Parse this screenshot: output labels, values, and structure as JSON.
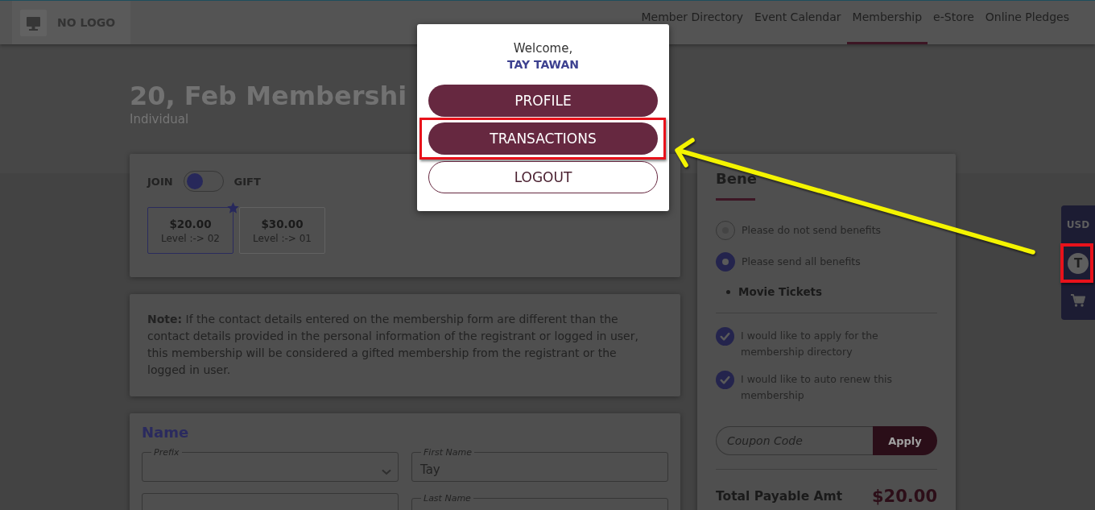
{
  "header": {
    "logo_text": "NO LOGO",
    "nav": [
      {
        "label": "Member Directory",
        "selected": false
      },
      {
        "label": "Event Calendar",
        "selected": false
      },
      {
        "label": "Membership",
        "selected": true
      },
      {
        "label": "e-Store",
        "selected": false
      },
      {
        "label": "Online Pledges",
        "selected": false
      }
    ]
  },
  "banner": {
    "title": "20, Feb Membershi",
    "subtitle": "Individual"
  },
  "membership_type": {
    "left_label": "JOIN",
    "right_label": "GIFT",
    "gift": false
  },
  "levels": [
    {
      "price": "$20.00",
      "level": "Level :-> 02",
      "selected": true,
      "starred": true
    },
    {
      "price": "$30.00",
      "level": "Level :-> 01",
      "selected": false,
      "starred": false
    }
  ],
  "note": "**Note:** If the contact details entered on the membership form are different than the contact details provided in the personal information of the registrant or logged in user, this membership will be considered a gifted membership from the registrant or the logged in user.",
  "name_section": {
    "title": "Name",
    "fields": [
      {
        "kind": "select",
        "label": "Prefix"
      },
      {
        "kind": "text",
        "label": "First Name",
        "value": "Tay"
      },
      {
        "kind": "text"
      },
      {
        "kind": "text",
        "label": "Last Name"
      }
    ]
  },
  "benefits": {
    "title": "Bene",
    "options": [
      {
        "label": "Please do not send benefits",
        "selected": false
      },
      {
        "label": "Please send all benefits",
        "selected": true
      }
    ],
    "items": [
      "Movie Tickets"
    ],
    "checkboxes": [
      {
        "label": "I would like to apply for the membership directory",
        "checked": true
      },
      {
        "label": "I would like to auto renew this membership",
        "checked": true
      }
    ],
    "coupon": {
      "placeholder": "Coupon Code",
      "button": "Apply"
    },
    "total": {
      "label": "Total Payable Amt",
      "amount": "$20.00"
    }
  },
  "side_toolbar": {
    "currency": "USD",
    "avatar_initial": "T",
    "avatar_highlighted": true
  },
  "user_menu": {
    "greeting": "Welcome,",
    "user_name": "TAY TAWAN",
    "buttons": [
      {
        "label": "PROFILE",
        "kind": "filled",
        "highlighted": false
      },
      {
        "label": "TRANSACTIONS",
        "kind": "filled",
        "highlighted": true
      },
      {
        "label": "LOGOUT",
        "kind": "outline",
        "highlighted": false
      }
    ]
  },
  "callout_arrow": true
}
